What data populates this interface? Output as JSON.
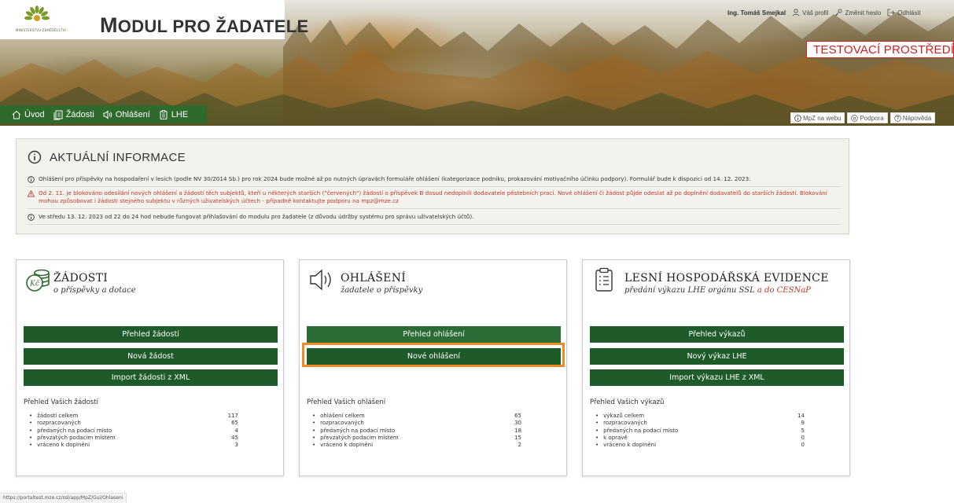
{
  "header": {
    "logo_caption": "MINISTERSTVO ZEMĚDĚLSTVÍ",
    "title_first": "M",
    "title_rest": "ODUL PRO ŽADATELE",
    "user_name": "Ing. Tomáš Smejkal",
    "profile_label": "Váš profil",
    "change_password_label": "Změnit heslo",
    "logout_label": "Odhlásit",
    "test_env_label": "TESTOVACÍ PROSTŘEDÍ",
    "nav": [
      {
        "label": "Úvod",
        "icon": "home-icon"
      },
      {
        "label": "Žádosti",
        "icon": "documents-icon"
      },
      {
        "label": "Ohlášení",
        "icon": "speaker-icon"
      },
      {
        "label": "LHE",
        "icon": "clipboard-icon"
      }
    ],
    "help_links": [
      {
        "label": "MpZ na webu",
        "icon": "info-icon"
      },
      {
        "label": "Podpora",
        "icon": "at-icon"
      },
      {
        "label": "Nápověda",
        "icon": "question-icon"
      }
    ]
  },
  "info": {
    "title": "AKTUÁLNÍ INFORMACE",
    "messages": [
      {
        "type": "info",
        "text": "Ohlášení pro příspěvky na hospodaření v lesích (podle NV 30/2014 Sb.) pro rok 2024 bude možné až po nutných úpravách formuláře ohlášení (kategorizace podniku, prokazování motivačního účinku podpory). Formulář bude k dispozici od 14. 12. 2023."
      },
      {
        "type": "warning",
        "text": "Od 2. 11. je blokováno odesílání nových ohlášení a žádostí těch subjektů, kteří u některých starších (\"červených\") žádostí o příspěvek B dosud nedoplnili dodavatele pěstebních prací. Nové ohlášení či žádost půjde odeslat až po doplnění dodavatelů do starších žádostí. Blokování mohou způsobovat i žádosti stejného subjektu v různých uživatelských účtech - případně kontaktujte podporu na mpz@mze.cz"
      },
      {
        "type": "info",
        "text": "Ve středu 13. 12. 2023 od 22 do 24 hod nebude fungovat přihlašování do modulu pro žadatele (z důvodu údržby systému pro správu uživatelských účtů)."
      }
    ]
  },
  "cards": {
    "zadosti": {
      "title": "ŽÁDOSTI",
      "subtitle": "o příspěvky a dotace",
      "buttons": [
        "Přehled žádostí",
        "Nová žádost",
        "Import žádosti z XML"
      ],
      "stats_title": "Přehled Vašich žádostí",
      "stats": [
        {
          "label": "žádostí celkem",
          "value": "117"
        },
        {
          "label": "rozpracovaných",
          "value": "65"
        },
        {
          "label": "předaných na podací místo",
          "value": "4"
        },
        {
          "label": "převzatých podacím místem",
          "value": "45"
        },
        {
          "label": "vráceno k doplnění",
          "value": "3"
        }
      ]
    },
    "ohlaseni": {
      "title": "OHLÁŠENÍ",
      "subtitle": "žadatele o příspěvky",
      "buttons": [
        "Přehled ohlášení",
        "Nové ohlášení"
      ],
      "stats_title": "Přehled Vašich ohlášení",
      "stats": [
        {
          "label": "ohlášení celkem",
          "value": "65"
        },
        {
          "label": "rozpracovaných",
          "value": "30"
        },
        {
          "label": "předaných na podací místo",
          "value": "18"
        },
        {
          "label": "převzatých podacím místem",
          "value": "15"
        },
        {
          "label": "vráceno k doplnění",
          "value": "2"
        }
      ]
    },
    "lhe": {
      "title": "LESNÍ HOSPODÁŘSKÁ EVIDENCE",
      "subtitle_main": "předání výkazu LHE orgánu SSL",
      "subtitle_red": " a do CESNaP",
      "buttons": [
        "Přehled výkazů",
        "Nový výkaz LHE",
        "Import výkazu LHE z XML"
      ],
      "stats_title": "Přehled Vašich výkazů",
      "stats": [
        {
          "label": "výkazů celkem",
          "value": "14"
        },
        {
          "label": "rozpracovaných",
          "value": "9"
        },
        {
          "label": "předaných na podací místo",
          "value": "5"
        },
        {
          "label": "k opravě",
          "value": "0"
        },
        {
          "label": "vráceno k doplnění",
          "value": "0"
        }
      ]
    }
  },
  "statusbar": {
    "url": "https://portaltest.mze.cz/ssl/app/MpZ/Gui/Ohlaseni"
  },
  "colors": {
    "nav_green": "#2d6a2c",
    "button_green": "#1e5a2a",
    "highlight_orange": "#f08a24",
    "warning_red": "#c0392b"
  }
}
